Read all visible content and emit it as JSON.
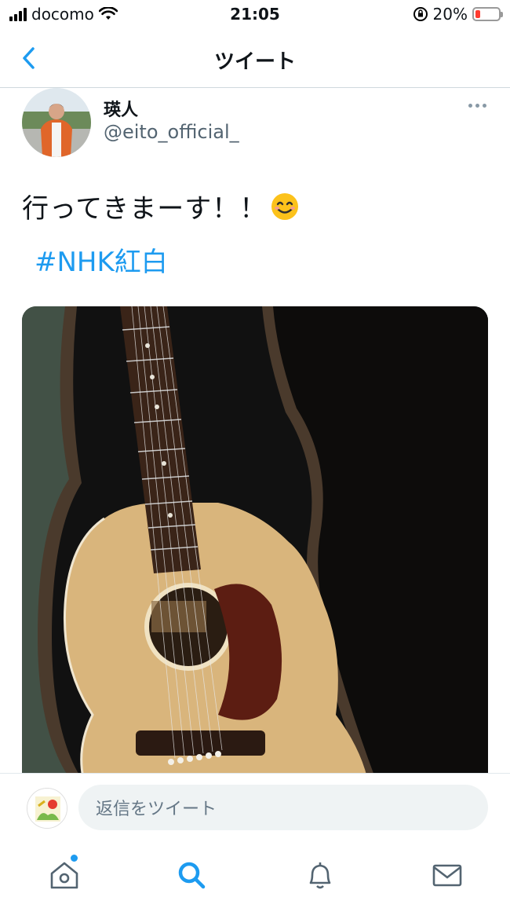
{
  "status_bar": {
    "carrier": "docomo",
    "time": "21:05",
    "battery_percent": "20%",
    "battery_level": 0.2,
    "battery_color": "#ff3b30"
  },
  "header": {
    "title": "ツイート",
    "back_icon": "chevron-left-icon"
  },
  "tweet": {
    "user_name": "瑛人",
    "user_handle": "@eito_official_",
    "text": "行ってきまーす！！",
    "emoji": "😊",
    "hashtag": "#NHK紅白",
    "more_icon": "more-horizontal-icon"
  },
  "reply": {
    "placeholder": "返信をツイート"
  },
  "tab_bar": {
    "items": [
      {
        "icon": "home-icon",
        "has_notification": true
      },
      {
        "icon": "search-icon",
        "active": true
      },
      {
        "icon": "bell-icon"
      },
      {
        "icon": "mail-icon"
      }
    ]
  },
  "colors": {
    "accent": "#1d9bf0",
    "text": "#0f1419",
    "secondary": "#536471"
  }
}
